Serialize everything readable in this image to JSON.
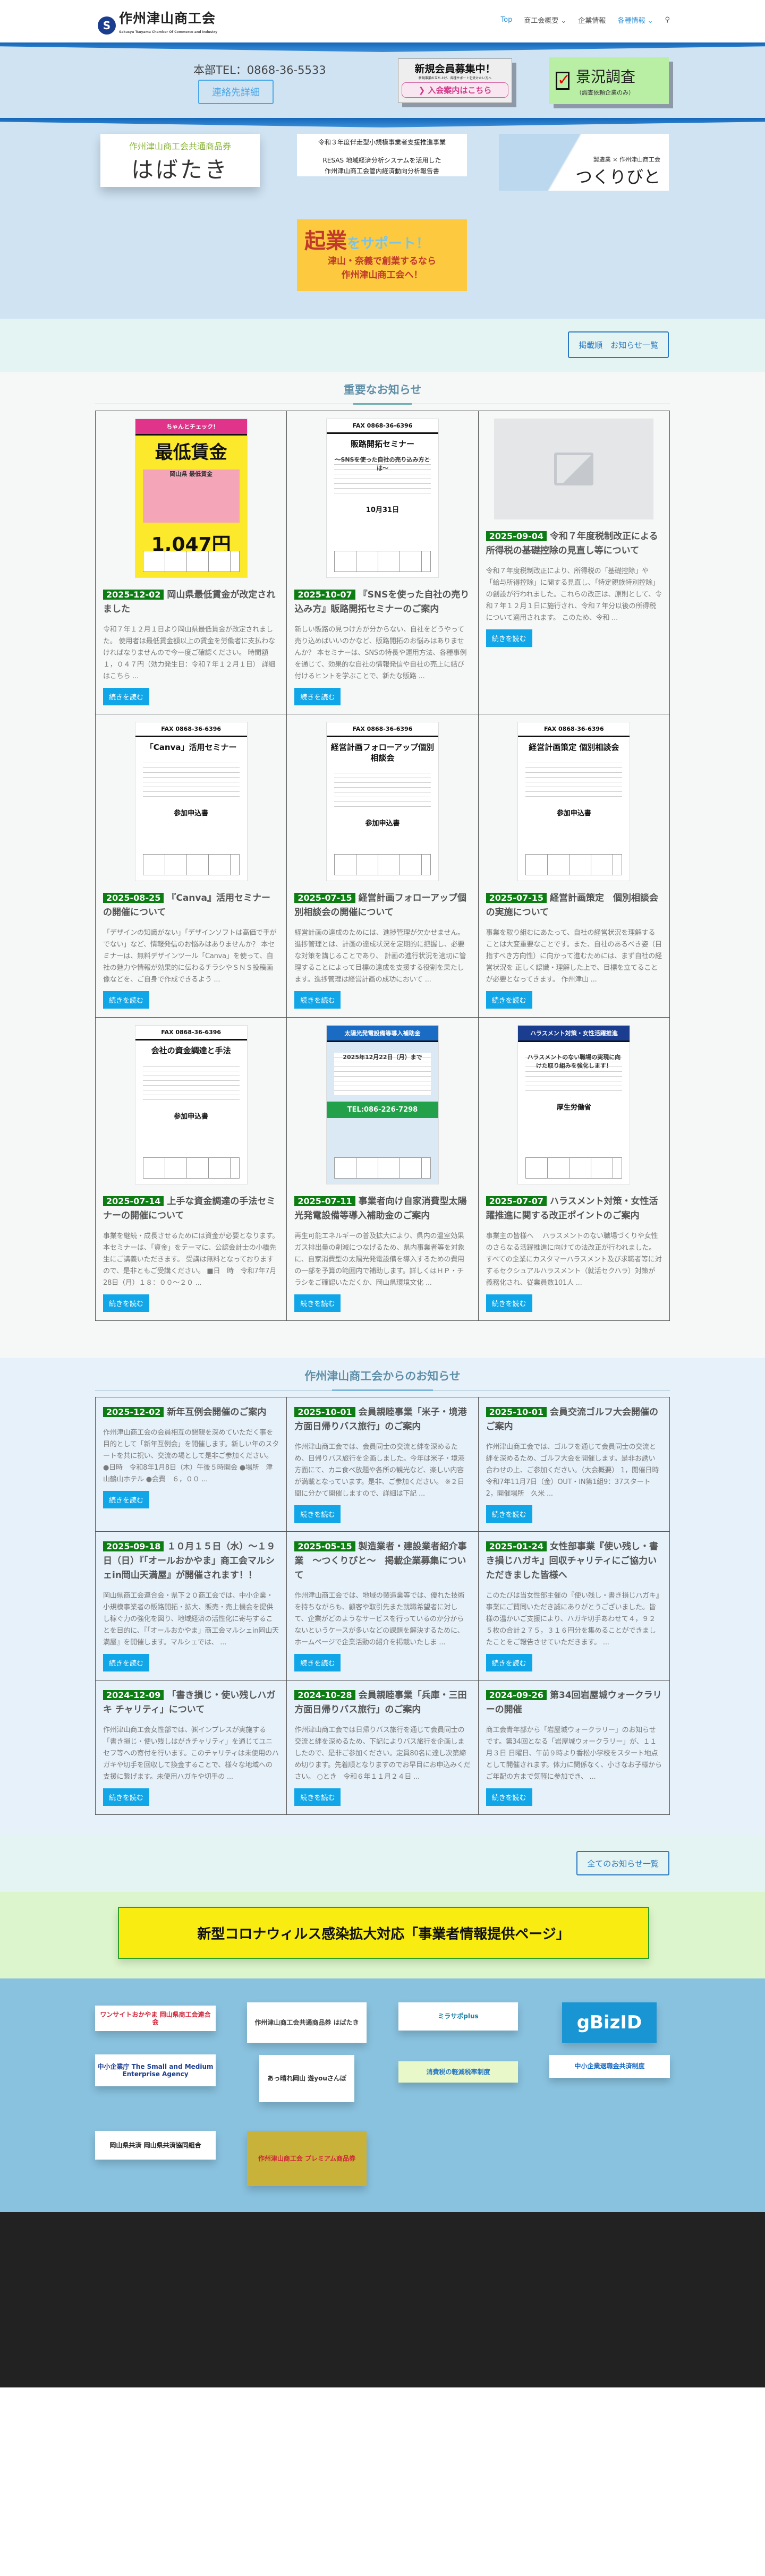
{
  "header": {
    "logo_mark": "S",
    "logo_title": "作州津山商工会",
    "logo_sub": "Sakusyu Tsuyama Chamber Of Commerce and Industry",
    "nav": [
      {
        "label": "Top",
        "active": true
      },
      {
        "label": "商工会概要 ⌄"
      },
      {
        "label": "企業情報"
      },
      {
        "label": "各種情報 ⌄",
        "active": true
      },
      {
        "label": "⚲"
      }
    ]
  },
  "contact": {
    "tel": "本部TEL：0868-36-5533",
    "detail_button": "連絡先詳細"
  },
  "member_banner": {
    "title": "新規会員募集中！",
    "sub": "新規事業の立ち上げ、各種サポートを受けたい方へ",
    "link": "❯ 入会案内はこちら"
  },
  "survey_banner": {
    "check": "✓",
    "title": "景況調査",
    "sub": "（調査依頼企業のみ）"
  },
  "banners": {
    "habataki_top": "作州津山商工会共通商品券",
    "habataki": "はばたき",
    "resas": [
      "令和３年度伴走型小規模事業者支援推進事業",
      "RESAS 地域経済分析システムを活用した",
      "作州津山商工会管内経済動向分析報告書"
    ],
    "tsukuri_sub": "製造業 × 作州津山商工会",
    "tsukuri": "つくりびと",
    "kigyo_1": "起業",
    "kigyo_2": "をサポート！",
    "kigyo_3": "津山・奈義で創業するなら",
    "kigyo_4": "作州津山商工会へ！"
  },
  "notice_list_button": "掲載順　お知らせ一覧",
  "important": {
    "title": "重要なお知らせ",
    "more_label": "続きを読む",
    "items": [
      {
        "date": "2025-12-02",
        "title": "岡山県最低賃金が改定されました",
        "excerpt": "令和７年１２月１日より岡山県最低賃金が改定されました。 使用者は最低賃金額以上の賃金を労働者に支払わなければなりませんので今一度ご確認ください。 時間額１，０４７円（効力発生日：令和７年１２月１日） 詳細はこちら ...",
        "thumb": "wage",
        "poster": [
          "ちゃんとチェック!",
          "最低賃金",
          "岡山県 最低賃金",
          "1,047円"
        ]
      },
      {
        "date": "2025-10-07",
        "title": "『SNSを使った自社の売り込み方』販路開拓セミナーのご案内",
        "excerpt": "新しい販路の見つけ方が分からない、自社をどうやって売り込めばいいのかなど、販路開拓のお悩みはありませんか？ 本セミナーは、SNSの特長や運用方法、各種事例を通じて、効果的な自社の情報発信や自社の売上に結び付けるヒントを学ぶことで、新たな販路 ...",
        "thumb": "flyer",
        "poster": [
          "FAX 0868-36-6396",
          "販路開拓セミナー",
          "～SNSを使った自社の売り込み方とは～",
          "10月31日"
        ]
      },
      {
        "date": "2025-09-04",
        "title": "令和７年度税制改正による所得税の基礎控除の見直し等について",
        "excerpt": "令和７年度税制改正により、所得税の「基礎控除」や「給与所得控除」に関する見直し、「特定親族特別控除」の創設が行われました。これらの改正は、原則として、令和７年１２月１日に施行され、令和７年分以後の所得税について適用されます。 このため、令和 ...",
        "thumb": "placeholder"
      },
      {
        "date": "2025-08-25",
        "title": "『Canva』活用セミナーの開催について",
        "excerpt": "「デザインの知識がない」「デザインソフトは高価で手がでない」など、情報発信のお悩みはありませんか？ 本セミナーは、無料デザインツール「Canva」を使って、自社の魅力や情報が効果的に伝わるチラシやＳＮＳ投稿画像などを、ご自身で作成できるよう ...",
        "thumb": "flyer",
        "poster": [
          "FAX 0868-36-6396",
          "「Canva」活用セミナー",
          "",
          "参加申込書"
        ]
      },
      {
        "date": "2025-07-15",
        "title": "経営計画フォローアップ個別相談会の開催について",
        "excerpt": "経営計画の達成のためには、進捗管理が欠かせません。進捗管理とは、計画の達成状況を定期的に把握し、必要な対策を講じることであり、 計画の進行状況を適切に管理することによって目標の達成を支援する役割を果たします。進捗管理は経営計画の成功において ...",
        "thumb": "flyer",
        "poster": [
          "FAX 0868-36-6396",
          "経営計画フォローアップ個別相談会",
          "",
          "参加申込書"
        ]
      },
      {
        "date": "2025-07-15",
        "title": "経営計画策定　個別相談会の実施について",
        "excerpt": "事業を取り組むにあたって、自社の経営状況を理解することは大変重要なことです。また、自社のあるべき姿（目指すべき方向性）に向かって進むためには、まず自社の経営状況を 正しく認識・理解した上で、目標を立てることが必要となってきます。 作州津山 ...",
        "thumb": "flyer",
        "poster": [
          "FAX 0868-36-6396",
          "経営計画策定 個別相談会",
          "",
          "参加申込書"
        ]
      },
      {
        "date": "2025-07-14",
        "title": "上手な資金調達の手法セミナーの開催について",
        "excerpt": "事業を継続・成長させるためには資金が必要となります。本セミナーは、「資金」をテーマに、公認会計士の小橋先生にご講義いただきます。 受講は無料となっておりますので、是非ともご受講ください。 ■日　時　令和7年7月28日（月）１８：００～２０ ...",
        "thumb": "flyer",
        "poster": [
          "FAX 0868-36-6396",
          "会社の資金調達と手法",
          "",
          "参加申込書"
        ]
      },
      {
        "date": "2025-07-11",
        "title": "事業者向け自家消費型太陽光発電設備等導入補助金のご案内",
        "excerpt": "再生可能エネルギーの普及拡大により、県内の温室効果ガス排出量の削減につなげるため、県内事業者等を対象に、自家消費型の太陽光発電設備を導入するための費用の一部を予算の範囲内で補助します。詳しくはＨＰ・チラシをご確認いただくか、岡山県環境文化 ...",
        "thumb": "solar",
        "poster": [
          "太陽光発電設備等導入補助金",
          "",
          "2025年12月22日（月）まで",
          "TEL:086-226-7298"
        ]
      },
      {
        "date": "2025-07-07",
        "title": "ハラスメント対策・女性活躍推進に関する改正ポイントのご案内",
        "excerpt": "事業主の皆様へ　 ハラスメントのない職場づくりや女性のさらなる活躍推進に向けての法改正が行われました。 すべての企業にカスタマーハラスメント及び求職者等に対するセクシュアルハラスメント（就活セクハラ）対策が義務化され、従業員数101人 ...",
        "thumb": "harass",
        "poster": [
          "ハラスメント対策・女性活躍推進",
          "",
          "ハラスメントのない職場の実現に向けた取り組みを強化します！",
          "厚生労働省"
        ]
      }
    ]
  },
  "association": {
    "title": "作州津山商工会からのお知らせ",
    "more_label": "続きを読む",
    "items": [
      {
        "date": "2025-12-02",
        "title": "新年互例会開催のご案内",
        "excerpt": "作州津山商工会の会員相互の懇親を深めていただく事を目的として「新年互例会」を開催します。新しい年のスタートを共に祝い、交流の場として是非ご参加ください。 ●日時　令和8年1月8日（木）午後５時開会 ●場所　津山鶴山ホテル ●会費　６，００ ..."
      },
      {
        "date": "2025-10-01",
        "title": "会員親睦事業「米子・境港方面日帰りバス旅行」のご案内",
        "excerpt": "作州津山商工会では、会員同士の交流と絆を深めるため、日帰りバス旅行を企画しました。今年は米子・境港方面にて、カニ食べ放題や各所の観光など、楽しい内容が満載となっています。是非、ご参加ください。 ※２日間に分かて開催しますので、詳細は下記 ..."
      },
      {
        "date": "2025-10-01",
        "title": "会員交流ゴルフ大会開催のご案内",
        "excerpt": "作州津山商工会では、ゴルフを通じて会員同士の交流と絆を深めるため、ゴルフ大会を開催します。是非お誘い合わせの上、ご参加ください。（大会概要） 1，開催日時　令和7年11月7日（金）OUT・IN第1組9：37スタート 2，開催場所　久米 ..."
      },
      {
        "date": "2025-09-18",
        "title": "１０月１５日（水）～１９日（日）『「オールおかやま」商工会マルシェin岡山天満屋』が開催されます！！",
        "excerpt": "岡山県商工会連合会・県下２０商工会では、中小企業・小規模事業者の販路開拓・拡大、販売・売上機会を提供し稼ぐ力の強化を図り、地域経済の活性化に寄与することを目的に、『「オールおかやま」商工会マルシェin岡山天満屋』を開催します。マルシェでは、 ..."
      },
      {
        "date": "2025-05-15",
        "title": "製造業者・建設業者紹介事業　～つくりびと～　掲載企業募集について",
        "excerpt": "作州津山商工会では、地域の製造業等では、優れた技術を持ちながらも、顧客や取引先また就職希望者に対して、企業がどのようなサービスを行っているのか分からないというケースが多いなどの課題を解決するために、ホームページで企業活動の紹介を掲載いたしま ..."
      },
      {
        "date": "2025-01-24",
        "title": "女性部事業『使い残し・書き損じハガキ』回収チャリティにご協力いただきました皆様へ",
        "excerpt": "このたびは当女性部主催の『使い残し・書き損じハガキ』事業にご賛同いただき誠にありがとうございました。皆様の温かいご支援により、ハガキ切手あわせて４，９２５枚の合計２７５，３１６円分を集めることができましたことをご報告させていただきます。 ..."
      },
      {
        "date": "2024-12-09",
        "title": "「書き損じ・使い残しハガキ チャリティ」について",
        "excerpt": "作州津山商工会女性部では、㈱インプレスが実施する「書き損じ・使い残しはがきチャリティ」を通じてユニセフ等への寄付を行います。このチャリティは未使用のハガキや切手を回収して換金することで、様々な地域への支援に繋げます。未使用ハガキや切手の ..."
      },
      {
        "date": "2024-10-28",
        "title": "会員親睦事業「兵庫・三田方面日帰りバス旅行」のご案内",
        "excerpt": "作州津山商工会では日帰りバス旅行を通じて会員同士の交流と絆を深めるため、下記によりバス旅行を企画しましたので、是非ご参加ください。定員80名に達し次第締め切ります。先着順となりますのでお早目にお申込みください。 ○とき　令和６年１１月２４日 ..."
      },
      {
        "date": "2024-09-26",
        "title": "第34回岩屋城ウォークラリーの開催",
        "excerpt": "商工会青年部から「岩屋城ウォークラリー」のお知らせです。第34回となる「岩屋城ウォークラリー」が、１１月３日 日曜日、午前９時より香松小学校をスタート地点として開催されます。体力に関係なく、小さなお子様からご年配の方まで気軽に参加でき、 ..."
      }
    ]
  },
  "all_notices_button": "全てのお知らせ一覧",
  "corona_banner": "新型コロナウィルス感染拡大対応「事業者情報提供ページ」",
  "links": [
    {
      "name": "onesite-okayama",
      "text": "ワンサイトおかやま 岡山県商工会連合会",
      "color": "#d0263a",
      "bg": "#ffffff"
    },
    {
      "name": "habataki",
      "text": "作州津山商工会共通商品券 はばたき",
      "color": "#444444",
      "bg": "#ffffff"
    },
    {
      "name": "mirasapo",
      "text": "ミラサポplus",
      "color": "#1f7fa6",
      "bg": "#ffffff"
    },
    {
      "name": "gbizid",
      "text": "gBizID",
      "color": "#ffffff",
      "bg": "#1a95d3"
    },
    {
      "name": "chusho-kigyo-cho",
      "text": "中小企業庁 The Small and Medium Enterprise Agency",
      "color": "#1b3d8f",
      "bg": "#ffffff"
    },
    {
      "name": "appare-okayama",
      "text": "あっ晴れ岡山 遊youさんぽ",
      "color": "#333333",
      "bg": "#ffffff"
    },
    {
      "name": "keigen-zeiritsu",
      "text": "消費税の軽減税率制度",
      "color": "#2a78c4",
      "bg": "#e8f8c8"
    },
    {
      "name": "chutaikyo",
      "text": "中小企業退職金共済制度",
      "color": "#1a6bc4",
      "bg": "#ffffff"
    },
    {
      "name": "okayama-kyosai",
      "text": "岡山県共済 岡山県共済協同組合",
      "color": "#222222",
      "bg": "#ffffff"
    },
    {
      "name": "premium-ticket",
      "text": "作州津山商工会 プレミアム商品券",
      "color": "#d0263a",
      "bg": "#c9b23a"
    }
  ]
}
